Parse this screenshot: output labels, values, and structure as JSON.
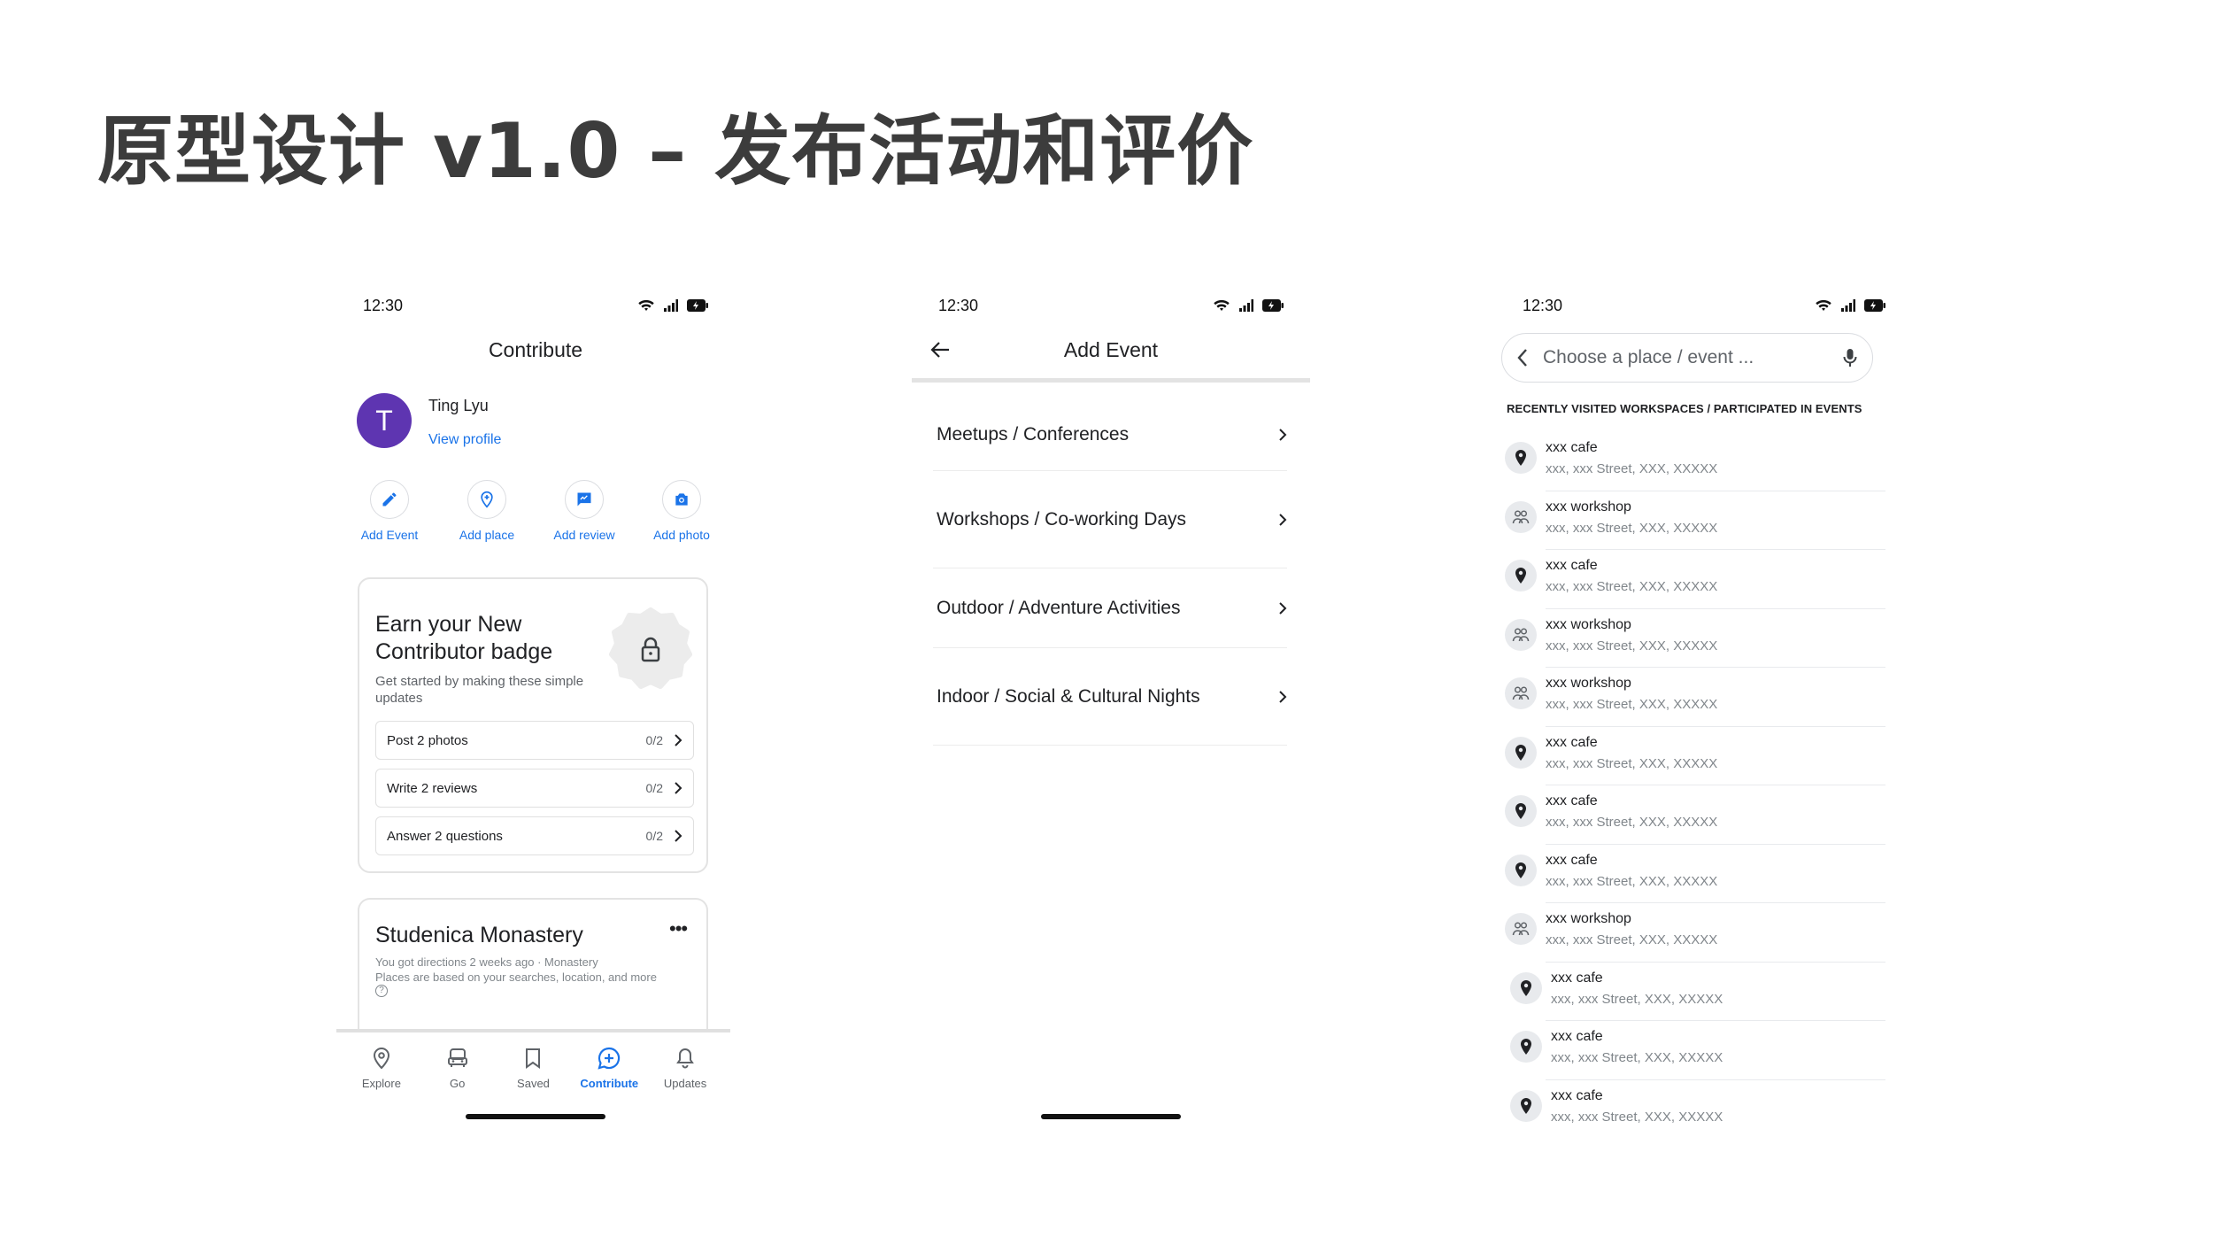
{
  "slide": {
    "title": "原型设计 v1.0 – 发布活动和评价"
  },
  "status_bar": {
    "time": "12:30"
  },
  "screen1": {
    "title": "Contribute",
    "profile": {
      "initial": "T",
      "name": "Ting Lyu",
      "link": "View profile"
    },
    "actions": [
      {
        "label": "Add Event",
        "icon": "pencil-icon"
      },
      {
        "label": "Add place",
        "icon": "add-place-icon"
      },
      {
        "label": "Add review",
        "icon": "review-icon"
      },
      {
        "label": "Add photo",
        "icon": "camera-icon"
      }
    ],
    "badge_card": {
      "title": "Earn your New Contributor badge",
      "subtitle": "Get started by making these simple updates",
      "tasks": [
        {
          "label": "Post 2 photos",
          "progress": "0/2"
        },
        {
          "label": "Write 2 reviews",
          "progress": "0/2"
        },
        {
          "label": "Answer 2 questions",
          "progress": "0/2"
        }
      ]
    },
    "place_card": {
      "title": "Studenica Monastery",
      "meta1": "You got directions 2 weeks ago · Monastery",
      "meta2": "Places are based on your searches, location, and more"
    },
    "nav": [
      {
        "label": "Explore",
        "icon": "explore-icon",
        "active": false
      },
      {
        "label": "Go",
        "icon": "commute-icon",
        "active": false
      },
      {
        "label": "Saved",
        "icon": "bookmark-icon",
        "active": false
      },
      {
        "label": "Contribute",
        "icon": "contribute-icon",
        "active": true
      },
      {
        "label": "Updates",
        "icon": "bell-icon",
        "active": false
      }
    ],
    "accent_color": "#1a73e8",
    "avatar_color": "#5e35b1"
  },
  "screen2": {
    "title": "Add Event",
    "categories": [
      "Meetups / Conferences",
      "Workshops / Co-working Days",
      "Outdoor / Adventure Activities",
      "Indoor / Social & Cultural Nights"
    ]
  },
  "screen3": {
    "search_placeholder": "Choose a place / event ...",
    "section_title": "RECENTLY VISITED WORKSPACES / PARTICIPATED IN EVENTS",
    "items": [
      {
        "name": "xxx cafe",
        "address": "xxx, xxx Street, XXX, XXXXX",
        "icon": "pin-icon"
      },
      {
        "name": "xxx workshop",
        "address": "xxx, xxx Street, XXX, XXXXX",
        "icon": "people-icon"
      },
      {
        "name": "xxx cafe",
        "address": "xxx, xxx Street, XXX, XXXXX",
        "icon": "pin-icon"
      },
      {
        "name": "xxx workshop",
        "address": "xxx, xxx Street, XXX, XXXXX",
        "icon": "people-icon"
      },
      {
        "name": "xxx workshop",
        "address": "xxx, xxx Street, XXX, XXXXX",
        "icon": "people-icon"
      },
      {
        "name": "xxx cafe",
        "address": "xxx, xxx Street, XXX, XXXXX",
        "icon": "pin-icon"
      },
      {
        "name": "xxx cafe",
        "address": "xxx, xxx Street, XXX, XXXXX",
        "icon": "pin-icon"
      },
      {
        "name": "xxx cafe",
        "address": "xxx, xxx Street, XXX, XXXXX",
        "icon": "pin-icon"
      },
      {
        "name": "xxx workshop",
        "address": "xxx, xxx Street, XXX, XXXXX",
        "icon": "people-icon"
      },
      {
        "name": "xxx cafe",
        "address": "xxx, xxx Street, XXX, XXXXX",
        "icon": "pin-icon"
      },
      {
        "name": "xxx cafe",
        "address": "xxx, xxx Street, XXX, XXXXX",
        "icon": "pin-icon"
      },
      {
        "name": "xxx cafe",
        "address": "xxx, xxx Street, XXX, XXXXX",
        "icon": "pin-icon"
      }
    ]
  }
}
